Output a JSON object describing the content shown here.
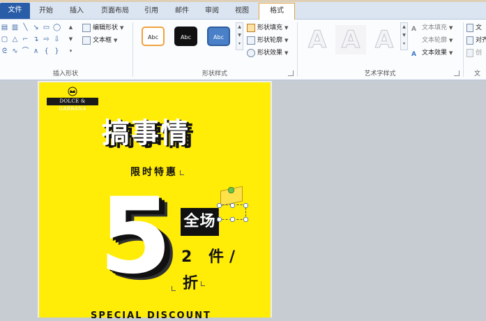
{
  "tabs": [
    {
      "label": "文件",
      "state": "file"
    },
    {
      "label": "开始",
      "state": "normal"
    },
    {
      "label": "插入",
      "state": "normal"
    },
    {
      "label": "页面布局",
      "state": "normal"
    },
    {
      "label": "引用",
      "state": "normal"
    },
    {
      "label": "邮件",
      "state": "normal"
    },
    {
      "label": "审阅",
      "state": "normal"
    },
    {
      "label": "视图",
      "state": "normal"
    },
    {
      "label": "格式",
      "state": "active"
    }
  ],
  "ribbon": {
    "insert_shapes": {
      "label": "插入形状",
      "edit_shape": "编辑形状",
      "text_box": "文本框"
    },
    "shape_styles": {
      "label": "形状样式",
      "swatch_text": "Abc",
      "fill": "形状填充",
      "outline": "形状轮廓",
      "effects": "形状效果"
    },
    "wordart_styles": {
      "label": "艺术字样式",
      "letter": "A",
      "text_fill": "文本填充",
      "text_outline": "文本轮廓",
      "text_effects": "文本效果"
    },
    "text": {
      "label": "文",
      "direction": "文",
      "align": "对齐",
      "link": "创"
    }
  },
  "poster": {
    "logo_text": "DOLCE & GABBANA",
    "headline": "搞事情",
    "subtitle": "限时特惠",
    "big_number": "5",
    "boxed_text": "全场",
    "line1": "2 件/",
    "line2": "折",
    "footer": "SPECIAL DISCOUNT"
  },
  "colors": {
    "poster_bg": "#ffec07",
    "file_tab": "#2a5da8",
    "active_tab_border": "#e2a33a"
  }
}
